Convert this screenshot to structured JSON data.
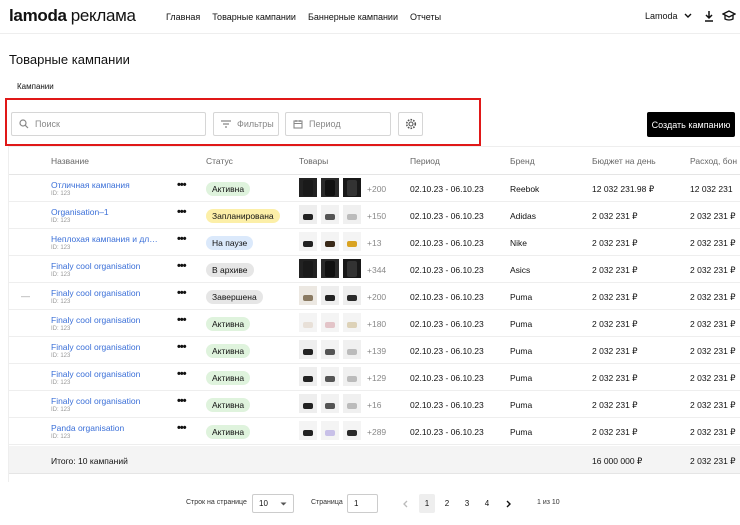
{
  "header": {
    "logo": "lamoda",
    "logo_suffix": "реклама",
    "nav": [
      "Главная",
      "Товарные кампании",
      "Баннерные кампании",
      "Отчеты"
    ],
    "account": "Lamoda"
  },
  "page": {
    "title": "Товарные кампании",
    "tab": "Кампании"
  },
  "filters": {
    "search_placeholder": "Поиск",
    "filters_label": "Фильтры",
    "period_placeholder": "Период",
    "create_label": "Создать кампанию"
  },
  "columns": [
    "Название",
    "Статус",
    "Товары",
    "Период",
    "Бренд",
    "Бюджет на день",
    "Расход, бон"
  ],
  "status_colors": {
    "Активна": "#dff3dd",
    "Запланирована": "#fcefa8",
    "На паузе": "#dbe9fb",
    "В архиве": "#e6e6e6",
    "Завершена": "#e6e6e6"
  },
  "rows": [
    {
      "name": "Отличная кампания",
      "id": "ID: 123",
      "status": "Активна",
      "more": "+200",
      "period": "02.10.23 - 06.10.23",
      "brand": "Reebok",
      "budget": "12 032 231.98 ₽",
      "spend": "12 032 231",
      "thumbs": "dark"
    },
    {
      "name": "Organisation–1",
      "id": "ID: 123",
      "status": "Запланирована",
      "more": "+150",
      "period": "02.10.23 - 06.10.23",
      "brand": "Adidas",
      "budget": "2 032 231 ₽",
      "spend": "2 032 231 ₽",
      "thumbs": "shoes"
    },
    {
      "name": "Неплохая кампания и длин...",
      "id": "ID: 123",
      "status": "На паузе",
      "more": "+13",
      "period": "02.10.23 - 06.10.23",
      "brand": "Nike",
      "budget": "2 032 231 ₽",
      "spend": "2 032 231 ₽",
      "thumbs": "glasses"
    },
    {
      "name": "Finaly cool organisation",
      "id": "ID: 123",
      "status": "В архиве",
      "more": "+344",
      "period": "02.10.23 - 06.10.23",
      "brand": "Asics",
      "budget": "2 032 231 ₽",
      "spend": "2 032 231 ₽",
      "thumbs": "dark"
    },
    {
      "name": "Finaly cool organisation",
      "id": "ID: 123",
      "status": "Завершена",
      "more": "+200",
      "period": "02.10.23 - 06.10.23",
      "brand": "Puma",
      "budget": "2 032 231 ₽",
      "spend": "2 032 231 ₽",
      "thumbs": "bags",
      "dash": "—"
    },
    {
      "name": "Finaly cool organisation",
      "id": "ID: 123",
      "status": "Активна",
      "more": "+180",
      "period": "02.10.23 - 06.10.23",
      "brand": "Puma",
      "budget": "2 032 231 ₽",
      "spend": "2 032 231 ₽",
      "thumbs": "hats"
    },
    {
      "name": "Finaly cool organisation",
      "id": "ID: 123",
      "status": "Активна",
      "more": "+139",
      "period": "02.10.23 - 06.10.23",
      "brand": "Puma",
      "budget": "2 032 231 ₽",
      "spend": "2 032 231 ₽",
      "thumbs": "shoes"
    },
    {
      "name": "Finaly cool organisation",
      "id": "ID: 123",
      "status": "Активна",
      "more": "+129",
      "period": "02.10.23 - 06.10.23",
      "brand": "Puma",
      "budget": "2 032 231 ₽",
      "spend": "2 032 231 ₽",
      "thumbs": "shoes"
    },
    {
      "name": "Finaly cool organisation",
      "id": "ID: 123",
      "status": "Активна",
      "more": "+16",
      "period": "02.10.23 - 06.10.23",
      "brand": "Puma",
      "budget": "2 032 231 ₽",
      "spend": "2 032 231 ₽",
      "thumbs": "shoes"
    },
    {
      "name": "Panda organisation",
      "id": "ID: 123",
      "status": "Активна",
      "more": "+289",
      "period": "02.10.23 - 06.10.23",
      "brand": "Puma",
      "budget": "2 032 231 ₽",
      "spend": "2 032 231 ₽",
      "thumbs": "mixed"
    }
  ],
  "total": {
    "label": "Итого: 10 кампаний",
    "budget": "16 000 000 ₽",
    "spend": "2 032 231 ₽"
  },
  "pagination": {
    "rows_label": "Строк на странице",
    "rows_value": "10",
    "page_label": "Страница",
    "page_value": "1",
    "pages": [
      "1",
      "2",
      "3",
      "4"
    ],
    "summary": "1 из 10"
  }
}
